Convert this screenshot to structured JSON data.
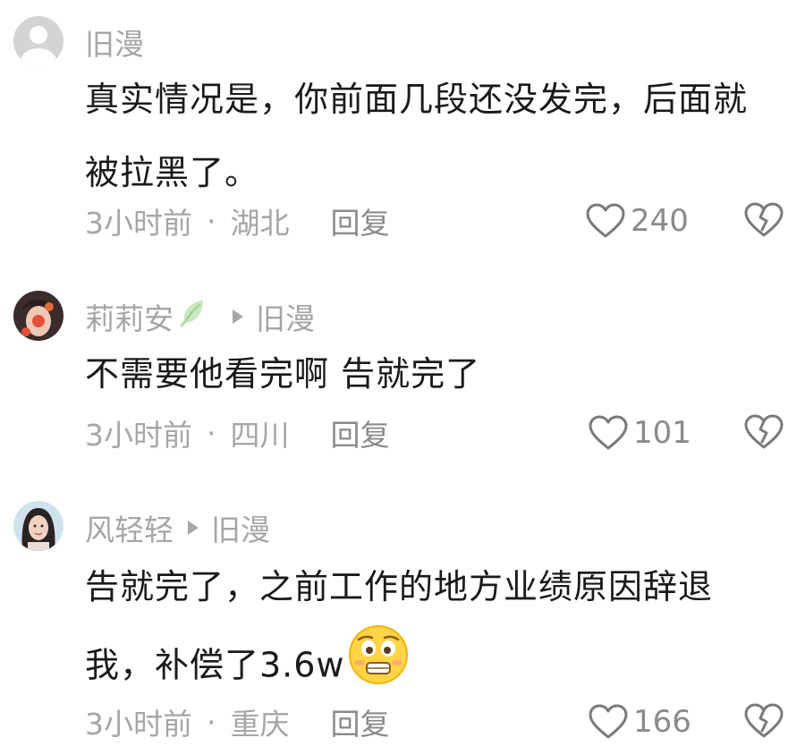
{
  "comments": [
    {
      "username": "旧漫",
      "has_leaf_badge": false,
      "reply_to": "",
      "content_lines": [
        "真实情况是，你前面几段还没发完，后面就",
        "被拉黑了。"
      ],
      "time": "3小时前",
      "separator": "·",
      "location": "湖北",
      "reply_label": "回复",
      "likes": "240",
      "avatar_icon": "default-avatar-icon"
    },
    {
      "username": "莉莉安",
      "has_leaf_badge": true,
      "reply_to": "旧漫",
      "content_lines": [
        "不需要他看完啊 告就完了"
      ],
      "time": "3小时前",
      "separator": "·",
      "location": "四川",
      "reply_label": "回复",
      "likes": "101",
      "avatar_icon": "user-photo-avatar"
    },
    {
      "username": "风轻轻",
      "has_leaf_badge": false,
      "reply_to": "旧漫",
      "content_lines": [
        "告就完了，之前工作的地方业绩原因辞退",
        "我，补偿了3.6w"
      ],
      "content_emoji": "worried-face-emoji",
      "time": "3小时前",
      "separator": "·",
      "location": "重庆",
      "reply_label": "回复",
      "likes": "166",
      "avatar_icon": "user-photo-avatar"
    }
  ],
  "colors": {
    "text_primary": "#1a1a1a",
    "text_secondary": "#a6a6a6",
    "icon_gray": "#7a7a7a"
  }
}
